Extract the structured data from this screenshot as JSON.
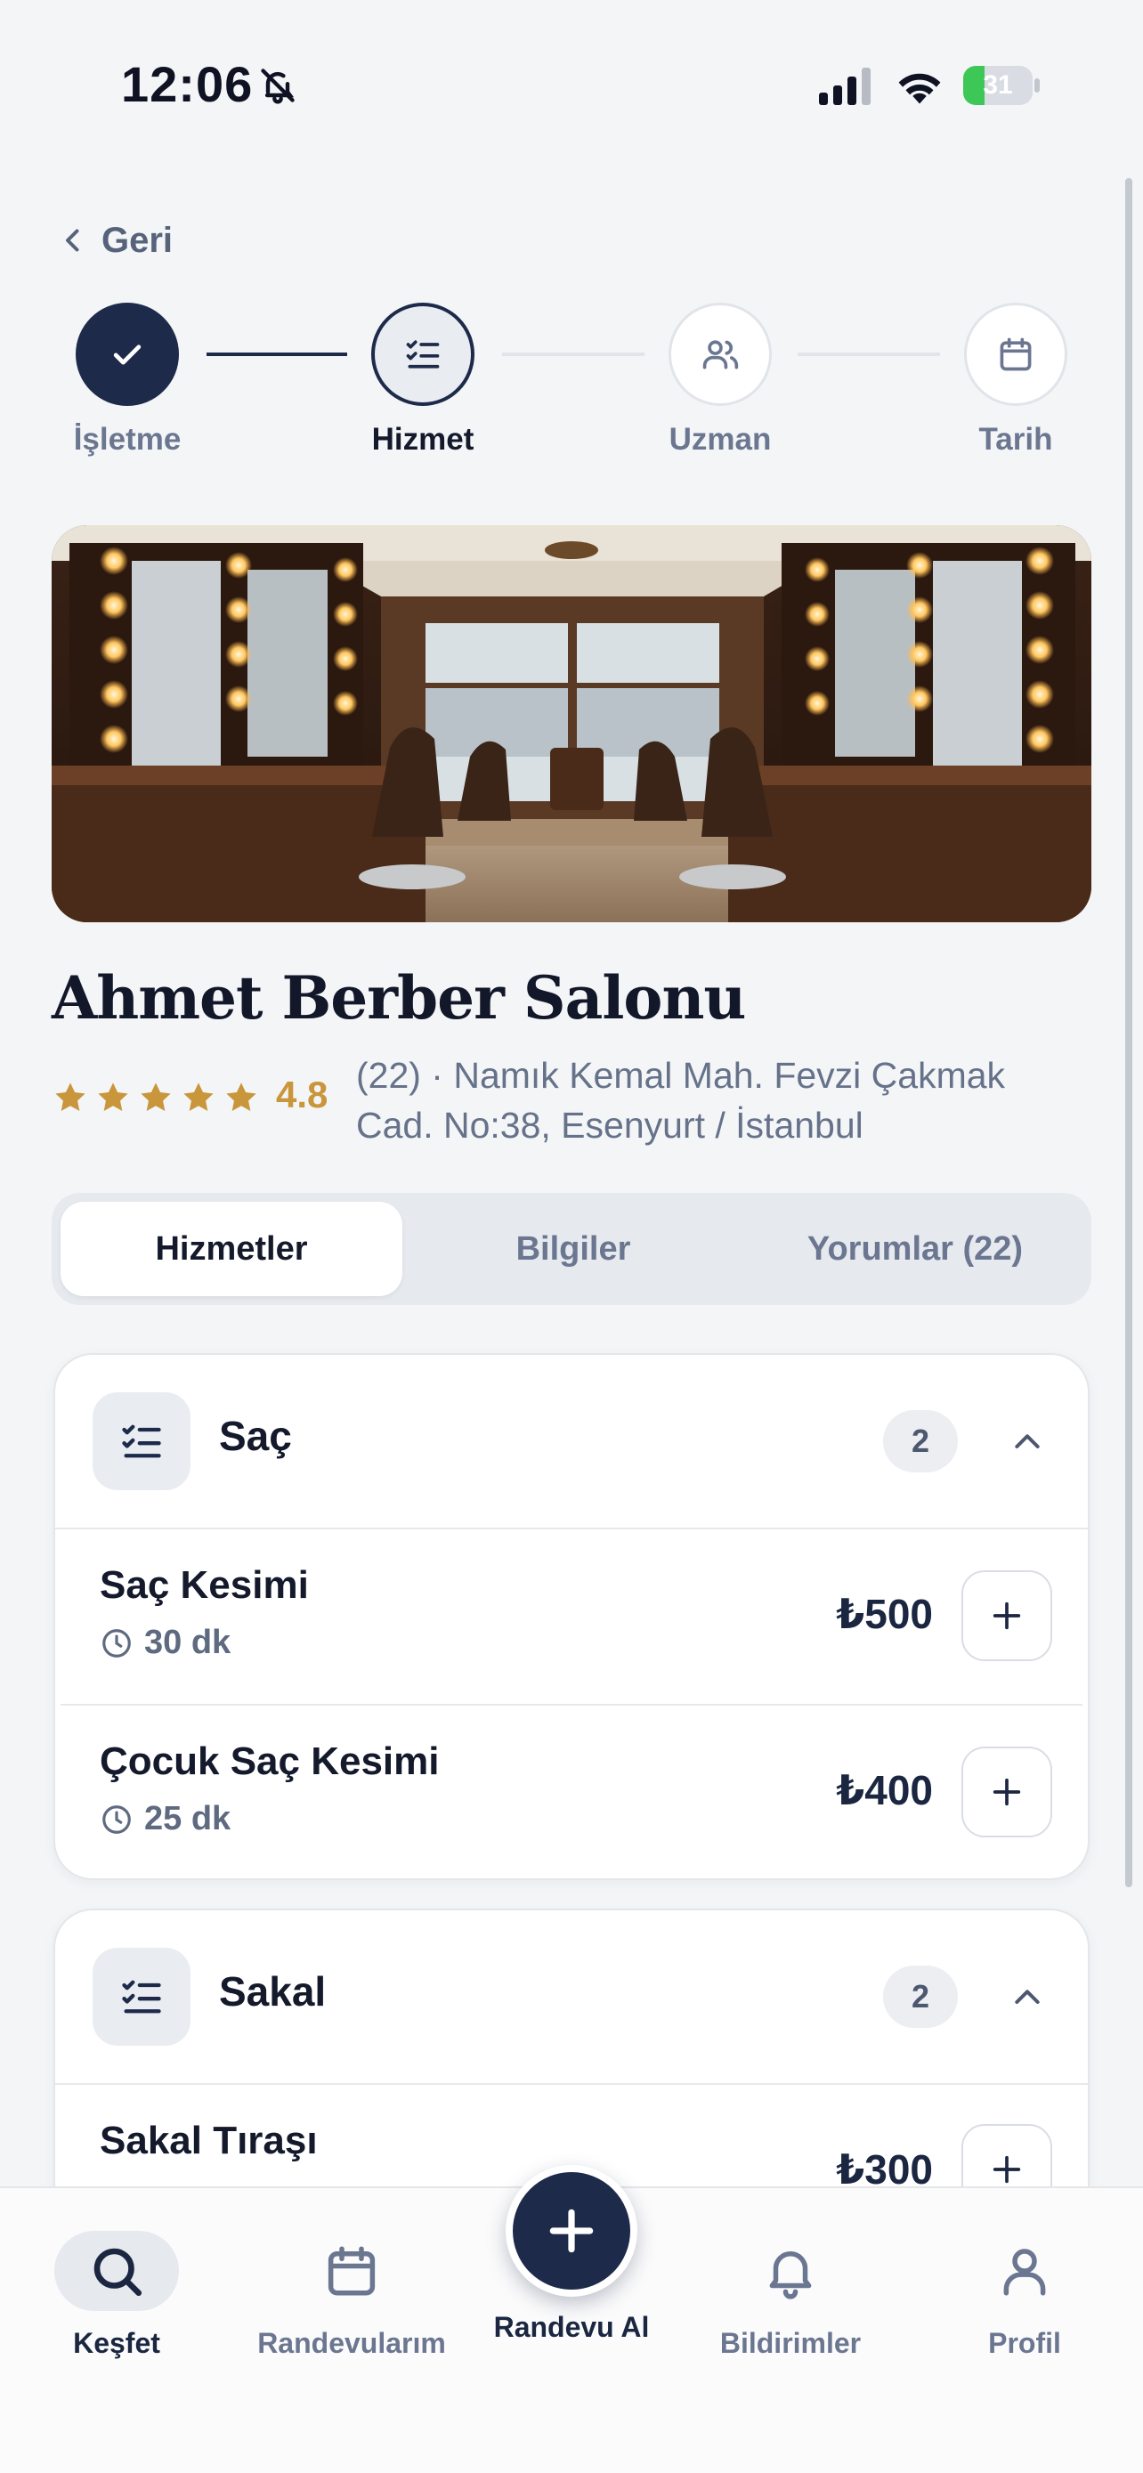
{
  "status_bar": {
    "time": "12:06",
    "battery": "31",
    "battery_level": 0.31
  },
  "back": {
    "label": "Geri"
  },
  "stepper": {
    "steps": [
      {
        "label": "İşletme",
        "state": "done",
        "icon": "check-icon"
      },
      {
        "label": "Hizmet",
        "state": "current",
        "icon": "list-check-icon"
      },
      {
        "label": "Uzman",
        "state": "upcoming",
        "icon": "users-icon"
      },
      {
        "label": "Tarih",
        "state": "upcoming",
        "icon": "calendar-icon"
      }
    ]
  },
  "business": {
    "name": "Ahmet Berber Salonu",
    "rating": "4.8",
    "stars": 5,
    "review_address": "(22) · Namık Kemal Mah. Fevzi Çakmak Cad. No:38, Esenyurt / İstanbul"
  },
  "tabs": [
    {
      "label": "Hizmetler",
      "active": true
    },
    {
      "label": "Bilgiler",
      "active": false
    },
    {
      "label": "Yorumlar (22)",
      "active": false
    }
  ],
  "categories": [
    {
      "title": "Saç",
      "count": "2",
      "services": [
        {
          "name": "Saç Kesimi",
          "duration": "30 dk",
          "price": "₺500"
        },
        {
          "name": "Çocuk Saç Kesimi",
          "duration": "25 dk",
          "price": "₺400"
        }
      ]
    },
    {
      "title": "Sakal",
      "count": "2",
      "services": [
        {
          "name": "Sakal Tıraşı",
          "duration": "",
          "price": "₺300"
        }
      ]
    }
  ],
  "bottom_nav": {
    "items": [
      {
        "label": "Keşfet",
        "icon": "search-icon",
        "active": true
      },
      {
        "label": "Randevularım",
        "icon": "calendar-icon",
        "active": false
      },
      {
        "label": "Randevu Al",
        "icon": "plus-icon",
        "active": false
      },
      {
        "label": "Bildirimler",
        "icon": "bell-icon",
        "active": false
      },
      {
        "label": "Profil",
        "icon": "user-icon",
        "active": false
      }
    ]
  },
  "colors": {
    "primary": "#1d2a4a",
    "star": "#c9963c",
    "background": "#f4f5f7"
  }
}
